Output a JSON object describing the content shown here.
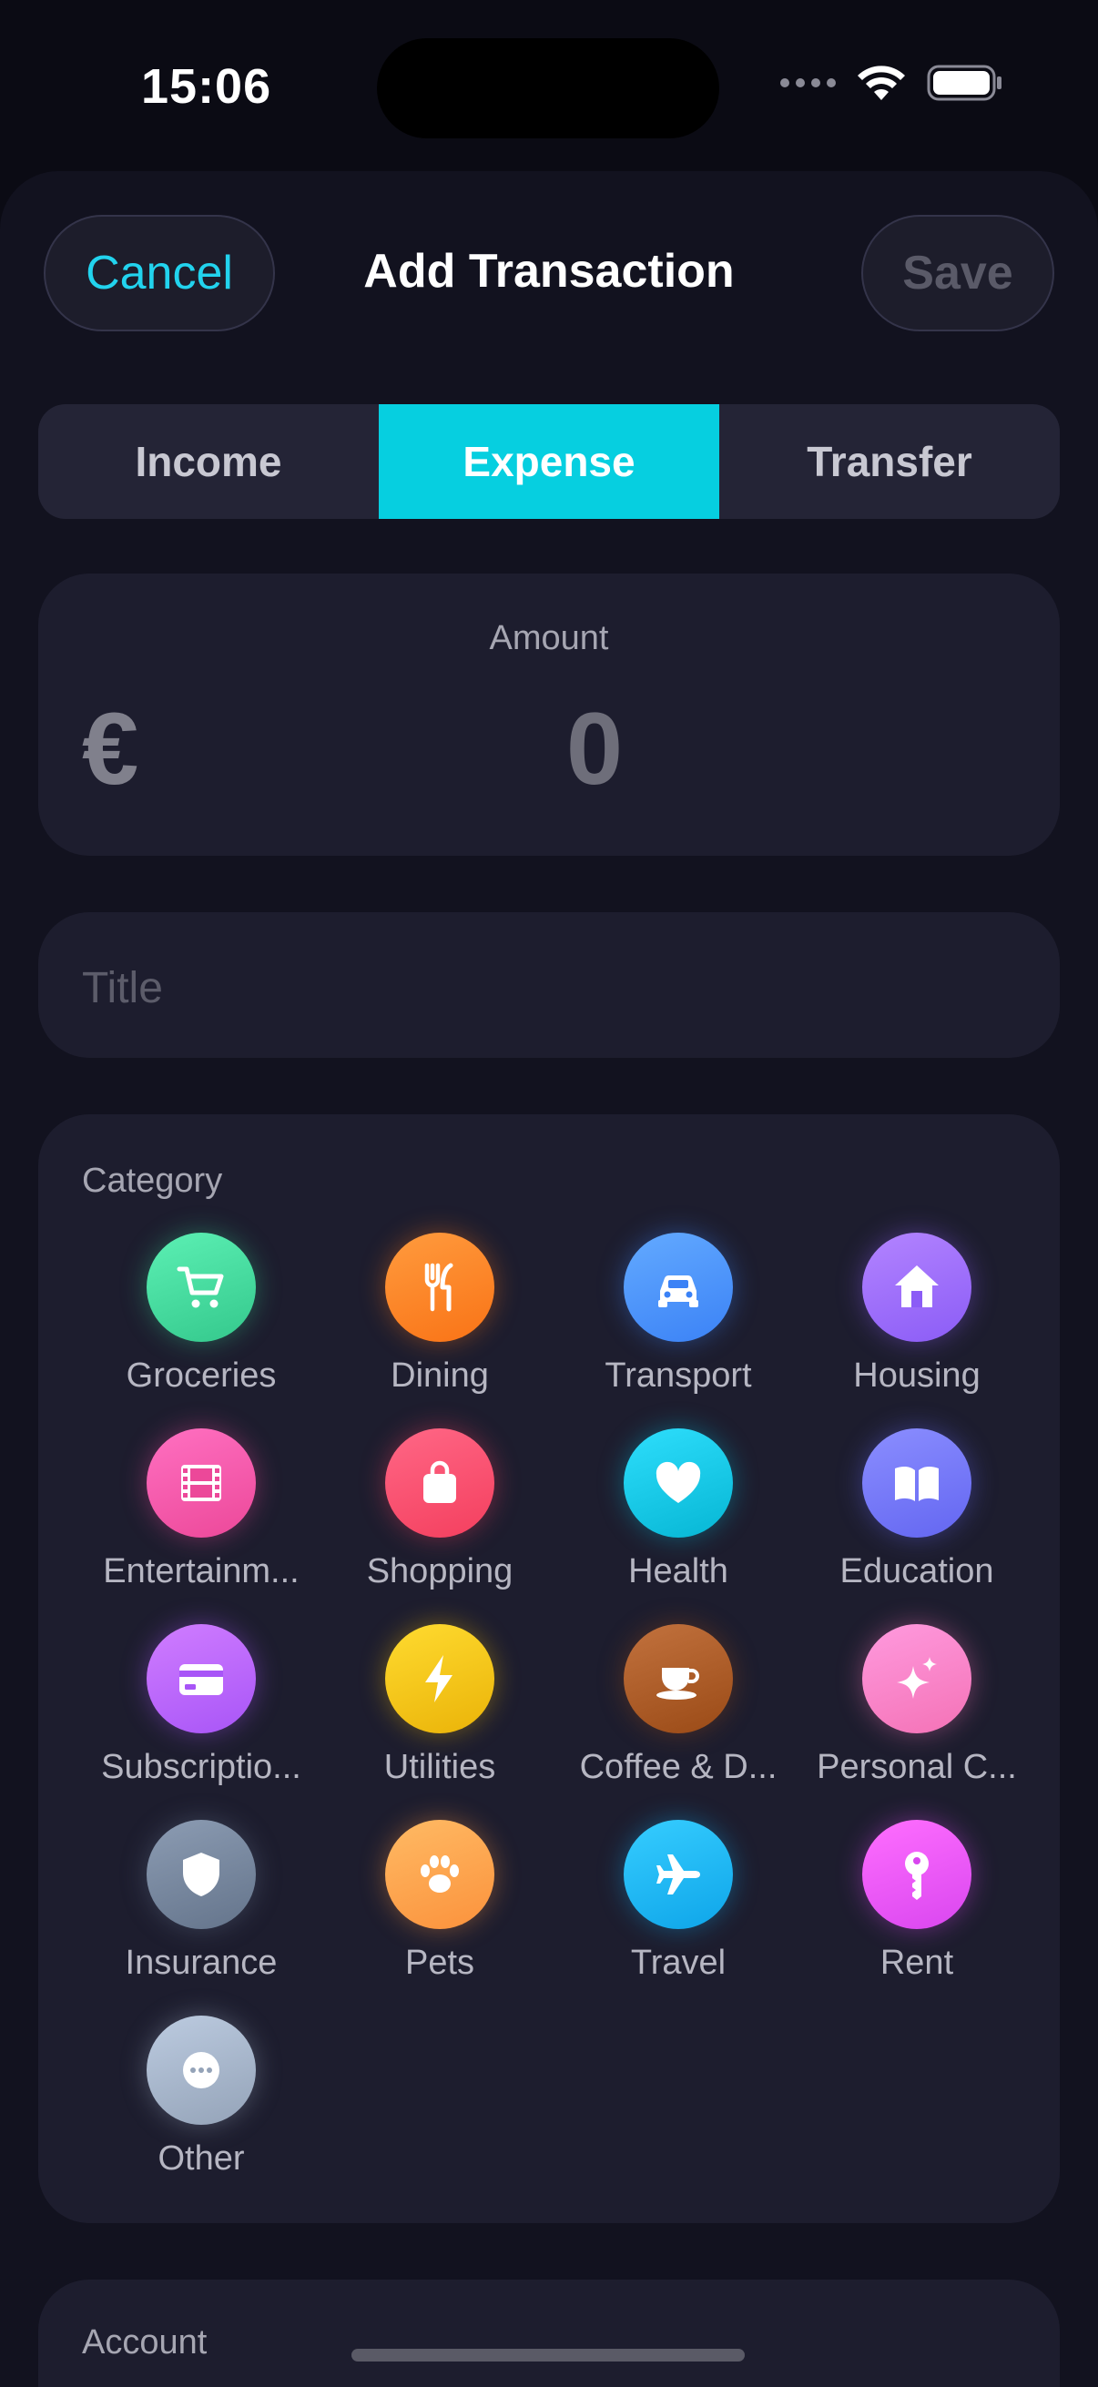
{
  "status_bar": {
    "time": "15:06"
  },
  "header": {
    "title": "Add Transaction",
    "cancel_label": "Cancel",
    "save_label": "Save"
  },
  "segments": [
    {
      "label": "Income",
      "active": false
    },
    {
      "label": "Expense",
      "active": true
    },
    {
      "label": "Transfer",
      "active": false
    }
  ],
  "amount": {
    "label": "Amount",
    "currency": "€",
    "value": "0"
  },
  "title_field": {
    "placeholder": "Title",
    "value": ""
  },
  "category": {
    "label": "Category",
    "items": [
      {
        "label": "Groceries",
        "icon": "cart-icon",
        "color": "#34c88c"
      },
      {
        "label": "Dining",
        "icon": "fork-knife-icon",
        "color": "#f97316"
      },
      {
        "label": "Transport",
        "icon": "car-icon",
        "color": "#3b82f6"
      },
      {
        "label": "Housing",
        "icon": "house-icon",
        "color": "#8b5cf6"
      },
      {
        "label": "Entertainm...",
        "icon": "film-icon",
        "color": "#ec4899"
      },
      {
        "label": "Shopping",
        "icon": "bag-icon",
        "color": "#f43f5e"
      },
      {
        "label": "Health",
        "icon": "heart-icon",
        "color": "#06b6d4"
      },
      {
        "label": "Education",
        "icon": "book-icon",
        "color": "#6366f1"
      },
      {
        "label": "Subscriptio...",
        "icon": "credit-card-icon",
        "color": "#a855f7"
      },
      {
        "label": "Utilities",
        "icon": "bolt-icon",
        "color": "#eab308"
      },
      {
        "label": "Coffee & D...",
        "icon": "coffee-cup-icon",
        "color": "#9a4a16"
      },
      {
        "label": "Personal C...",
        "icon": "sparkles-icon",
        "color": "#f472b6"
      },
      {
        "label": "Insurance",
        "icon": "shield-icon",
        "color": "#64748b"
      },
      {
        "label": "Pets",
        "icon": "paw-icon",
        "color": "#fb923c"
      },
      {
        "label": "Travel",
        "icon": "airplane-icon",
        "color": "#0ea5e9"
      },
      {
        "label": "Rent",
        "icon": "key-icon",
        "color": "#d946ef"
      },
      {
        "label": "Other",
        "icon": "ellipsis-icon",
        "color": "#94a3b8"
      }
    ]
  },
  "account": {
    "label": "Account"
  },
  "colors": {
    "accent": "#06cfe0",
    "cancel": "#22d3ee",
    "sheet": "#12121f",
    "card": "#1d1d2e"
  }
}
